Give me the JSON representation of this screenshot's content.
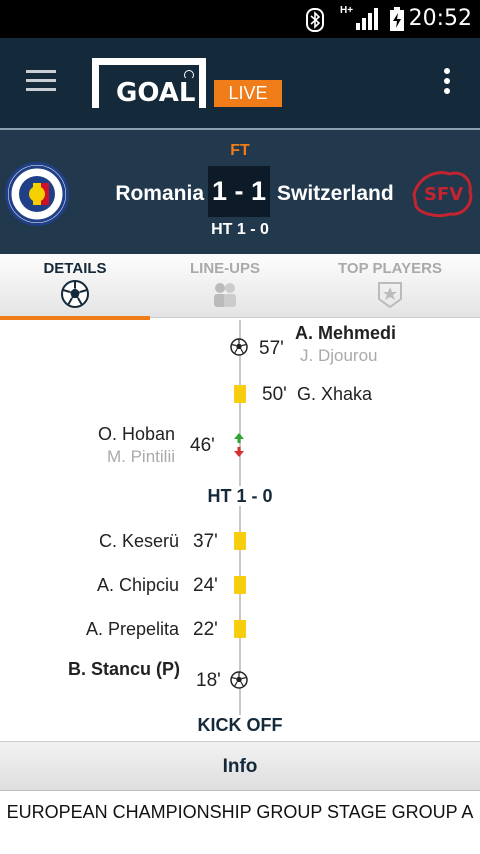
{
  "status_bar": {
    "time": "20:52",
    "network": "H+"
  },
  "app_bar": {
    "logo_text": "GOAL",
    "live_label": "LIVE"
  },
  "match": {
    "status": "FT",
    "home_team": "Romania",
    "away_team": "Switzerland",
    "score": "1 - 1",
    "half_time": "HT 1 - 0"
  },
  "tabs": [
    {
      "label": "DETAILS",
      "icon": "soccer-ball-icon",
      "active": true
    },
    {
      "label": "LINE-UPS",
      "icon": "players-icon",
      "active": false
    },
    {
      "label": "TOP PLAYERS",
      "icon": "star-badge-icon",
      "active": false
    }
  ],
  "timeline": {
    "events": [
      {
        "minute": "57'",
        "side": "away",
        "type": "goal",
        "player": "A. Mehmedi",
        "assist": "J. Djourou"
      },
      {
        "minute": "50'",
        "side": "away",
        "type": "yellow-card",
        "player": "G. Xhaka"
      },
      {
        "minute": "46'",
        "side": "home",
        "type": "substitution",
        "player_in": "O. Hoban",
        "player_out": "M. Pintilii"
      },
      {
        "minute": "37'",
        "side": "home",
        "type": "yellow-card",
        "player": "C. Keserü"
      },
      {
        "minute": "24'",
        "side": "home",
        "type": "yellow-card",
        "player": "A. Chipciu"
      },
      {
        "minute": "22'",
        "side": "home",
        "type": "yellow-card",
        "player": "A. Prepelita"
      },
      {
        "minute": "18'",
        "side": "home",
        "type": "goal",
        "player": "B. Stancu (P)"
      }
    ],
    "half_time_marker": "HT 1 - 0",
    "kick_off_marker": "KICK OFF"
  },
  "info_label": "Info",
  "competition": "EUROPEAN CHAMPIONSHIP GROUP STAGE GROUP A",
  "colors": {
    "accent": "#f07d1a",
    "header_bg": "#14293a",
    "card_yellow": "#f8cd0d"
  }
}
